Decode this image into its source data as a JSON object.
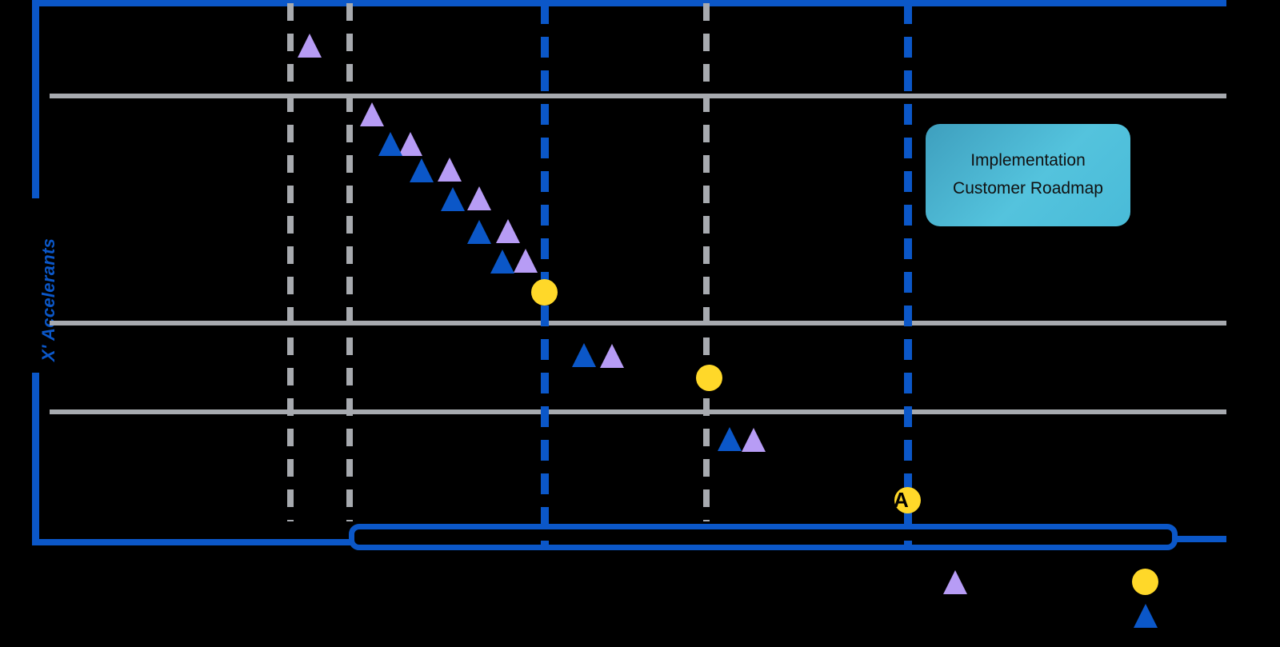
{
  "chart_data": {
    "type": "scatter",
    "title": "",
    "ylabel": "X' Accelerants",
    "xlabel": "",
    "grid": true,
    "legend_position": "bottom-right",
    "axis_color": "#0B57C8",
    "gridline_color": "#A7AAAF",
    "xlim": [
      0,
      1600
    ],
    "ylim": [
      0,
      700
    ],
    "series": [
      {
        "name": "purple-triangle-series",
        "marker": "triangle",
        "color": "#B79CF5",
        "points": [
          {
            "x": 386,
            "y": 58
          },
          {
            "x": 464,
            "y": 144
          },
          {
            "x": 512,
            "y": 180
          },
          {
            "x": 561,
            "y": 212
          },
          {
            "x": 598,
            "y": 248
          },
          {
            "x": 634,
            "y": 288
          },
          {
            "x": 656,
            "y": 325
          },
          {
            "x": 764,
            "y": 444
          },
          {
            "x": 941,
            "y": 549
          }
        ]
      },
      {
        "name": "blue-triangle-series",
        "marker": "triangle",
        "color": "#0B57C8",
        "points": [
          {
            "x": 487,
            "y": 180
          },
          {
            "x": 526,
            "y": 213
          },
          {
            "x": 565,
            "y": 249
          },
          {
            "x": 598,
            "y": 290
          },
          {
            "x": 627,
            "y": 326
          },
          {
            "x": 729,
            "y": 443
          },
          {
            "x": 911,
            "y": 548
          }
        ]
      },
      {
        "name": "yellow-milestone-series",
        "marker": "circle",
        "color": "#FFD829",
        "points": [
          {
            "x": 681,
            "y": 365
          },
          {
            "x": 886,
            "y": 471
          },
          {
            "x": 1135,
            "y": 625
          }
        ]
      }
    ],
    "gridlines": {
      "horizontal": [
        {
          "y": 120,
          "style": "solid",
          "color": "#A7AAAF"
        },
        {
          "y": 404,
          "style": "solid",
          "color": "#A7AAAF"
        },
        {
          "y": 515,
          "style": "solid",
          "color": "#A7AAAF"
        }
      ],
      "vertical": [
        {
          "x": 363,
          "style": "dashed",
          "color": "#A7AAAF"
        },
        {
          "x": 437,
          "style": "dashed",
          "color": "#A7AAAF"
        },
        {
          "x": 681,
          "style": "dashed",
          "color": "#0B57C8"
        },
        {
          "x": 883,
          "style": "dashed",
          "color": "#A7AAAF"
        },
        {
          "x": 1135,
          "style": "dashed",
          "color": "#0B57C8"
        }
      ]
    }
  },
  "callout": {
    "line1": "Implementation",
    "line2": "Customer Roadmap",
    "color_start": "#3E9FBE",
    "color_end": "#54C3DD"
  },
  "axis": {
    "y_title": "X' Accelerants",
    "color": "#0B57C8"
  },
  "phase_bar": {
    "label": "",
    "color": "#0B57C8"
  },
  "legend": {
    "items": [
      {
        "name": "purple-triangle",
        "marker": "triangle",
        "color": "#B79CF5",
        "label": ""
      },
      {
        "name": "yellow-circle",
        "marker": "circle",
        "color": "#FFD829",
        "label": ""
      },
      {
        "name": "blue-triangle",
        "marker": "triangle",
        "color": "#0B57C8",
        "label": ""
      }
    ]
  },
  "overlay": {
    "glyph": "A"
  }
}
